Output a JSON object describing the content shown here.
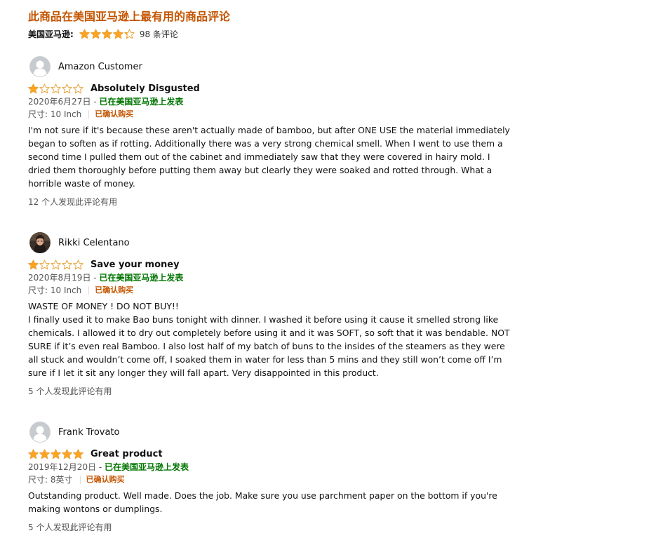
{
  "section": {
    "title": "此商品在美国亚马逊上最有用的商品评论",
    "summary_label": "美国亚马逊:",
    "summary_rating": 4.3,
    "summary_count": "98 条评论"
  },
  "colors": {
    "brand": "#c45500",
    "star": "#ffa41c",
    "verified_location": "#007600"
  },
  "reviews": [
    {
      "author": "Amazon Customer",
      "avatar": "default-avatar-icon",
      "rating": 1,
      "title": "Absolutely Disgusted",
      "date": "2020年6月27日 - ",
      "location": "已在美国亚马逊上发表",
      "format": "尺寸: 10 Inch",
      "verified": "已确认购买",
      "body": "I'm not sure if it's because these aren't actually made of bamboo, but after ONE USE the material immediately began to soften as if rotting. Additionally there was a very strong chemical smell. When I went to use them a second time I pulled them out of the cabinet and immediately saw that they were covered in hairy mold. I dried them thoroughly before putting them away but clearly they were soaked and rotted through. What a horrible waste of money.",
      "helpful": "12 个人发现此评论有用"
    },
    {
      "author": "Rikki Celentano",
      "avatar": "user-photo-avatar",
      "rating": 1,
      "title": "Save your money",
      "date": "2020年8月19日 - ",
      "location": "已在美国亚马逊上发表",
      "format": "尺寸: 10 Inch",
      "verified": "已确认购买",
      "body": "WASTE OF MONEY ! DO NOT BUY!!\nI finally used it to make Bao buns tonight with dinner. I washed it before using it cause it smelled strong like chemicals. I allowed it to dry out completely before using it and it was SOFT, so soft that it was bendable. NOT SURE if it’s even real Bamboo. I also lost half of my batch of buns to the insides of the steamers as they were all stuck and wouldn’t come off, I soaked them in water for less than 5 mins and they still won’t come off I’m sure if I let it sit any longer they will fall apart. Very disappointed in this product.",
      "helpful": "5 个人发现此评论有用"
    },
    {
      "author": "Frank Trovato",
      "avatar": "default-avatar-icon",
      "rating": 5,
      "title": "Great product",
      "date": "2019年12月20日 - ",
      "location": "已在美国亚马逊上发表",
      "format": "尺寸: 8英寸",
      "verified": "已确认购买",
      "body": "Outstanding product. Well made. Does the job. Make sure you use parchment paper on the bottom if you're making wontons or dumplings.",
      "helpful": "5 个人发现此评论有用"
    }
  ]
}
